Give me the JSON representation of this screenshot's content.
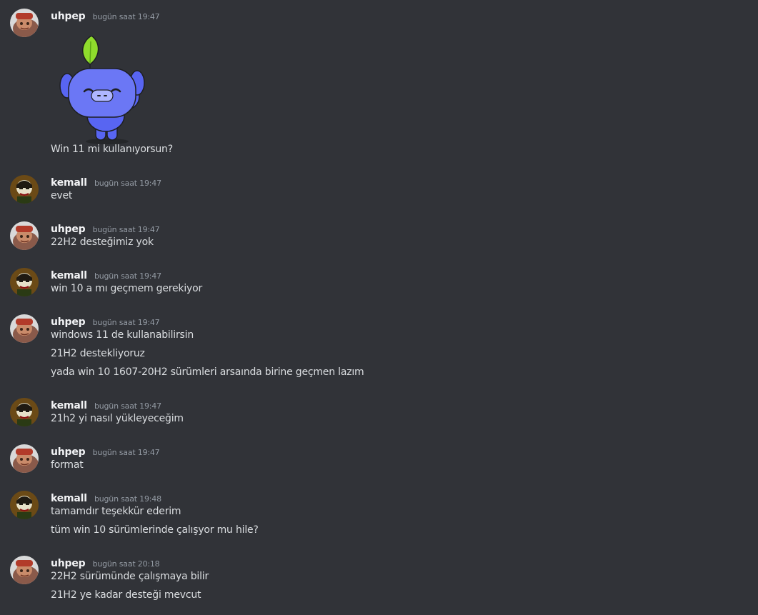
{
  "colors": {
    "background": "#313338",
    "username": "#f2f3f5",
    "timestamp": "#949ba4",
    "message_text": "#dbdee1",
    "sticker_body": "#5865f2",
    "sticker_leaf": "#8fdc2c"
  },
  "messages": [
    {
      "author": "uhpep",
      "timestamp": "bugün saat 19:47",
      "avatar_icon": "uhpep-avatar-icon",
      "sticker": "wumpus-wave-sticker",
      "lines": [
        "Win 11 mi kullanıyorsun?"
      ]
    },
    {
      "author": "kemall",
      "timestamp": "bugün saat 19:47",
      "avatar_icon": "kemall-avatar-icon",
      "lines": [
        "evet"
      ]
    },
    {
      "author": "uhpep",
      "timestamp": "bugün saat 19:47",
      "avatar_icon": "uhpep-avatar-icon",
      "lines": [
        "22H2 desteğimiz yok"
      ]
    },
    {
      "author": "kemall",
      "timestamp": "bugün saat 19:47",
      "avatar_icon": "kemall-avatar-icon",
      "lines": [
        "win 10 a mı geçmem gerekiyor"
      ]
    },
    {
      "author": "uhpep",
      "timestamp": "bugün saat 19:47",
      "avatar_icon": "uhpep-avatar-icon",
      "lines": [
        "windows 11 de kullanabilirsin",
        "21H2 destekliyoruz",
        "yada win 10 1607-20H2 sürümleri arsaında birine geçmen lazım"
      ]
    },
    {
      "author": "kemall",
      "timestamp": "bugün saat 19:47",
      "avatar_icon": "kemall-avatar-icon",
      "lines": [
        "21h2 yi nasıl yükleyeceğim"
      ]
    },
    {
      "author": "uhpep",
      "timestamp": "bugün saat 19:47",
      "avatar_icon": "uhpep-avatar-icon",
      "lines": [
        "format"
      ]
    },
    {
      "author": "kemall",
      "timestamp": "bugün saat 19:48",
      "avatar_icon": "kemall-avatar-icon",
      "lines": [
        "tamamdır teşekkür ederim",
        "tüm win 10 sürümlerinde çalışyor mu hile?"
      ]
    },
    {
      "author": "uhpep",
      "timestamp": "bugün saat 20:18",
      "avatar_icon": "uhpep-avatar-icon",
      "lines": [
        "22H2 sürümünde çalışmaya bilir",
        "21H2 ye kadar desteği mevcut"
      ]
    }
  ]
}
